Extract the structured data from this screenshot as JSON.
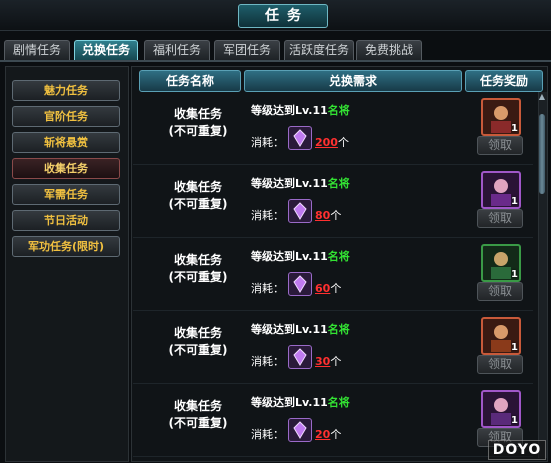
{
  "window": {
    "title": "任务"
  },
  "tabs": [
    {
      "label": "剧情任务",
      "active": false
    },
    {
      "label": "兑换任务",
      "active": true
    },
    {
      "label": "福利任务",
      "active": false
    },
    {
      "label": "军团任务",
      "active": false
    },
    {
      "label": "活跃度任务",
      "active": false
    },
    {
      "label": "免费挑战",
      "active": false
    }
  ],
  "sidebar": {
    "items": [
      {
        "label": "魅力任务"
      },
      {
        "label": "官阶任务"
      },
      {
        "label": "斩将悬赏"
      },
      {
        "label": "收集任务",
        "selected": true
      },
      {
        "label": "军需任务"
      },
      {
        "label": "节日活动"
      },
      {
        "label": "军功任务(限时)"
      }
    ]
  },
  "table": {
    "headers": {
      "name": "任务名称",
      "requirement": "兑换需求",
      "reward": "任务奖励"
    },
    "rows": [
      {
        "name_line1": "收集任务",
        "name_line2": "(不可重复)",
        "req_prefix": "等级达到Lv.11",
        "req_suffix": "名将",
        "cost_label": "消耗：",
        "cost_value": "200",
        "cost_unit": "个",
        "reward_count": "1",
        "reward_color": "orange",
        "claim_label": "领取"
      },
      {
        "name_line1": "收集任务",
        "name_line2": "(不可重复)",
        "req_prefix": "等级达到Lv.11",
        "req_suffix": "名将",
        "cost_label": "消耗：",
        "cost_value": "80",
        "cost_unit": "个",
        "reward_count": "1",
        "reward_color": "purple",
        "claim_label": "领取"
      },
      {
        "name_line1": "收集任务",
        "name_line2": "(不可重复)",
        "req_prefix": "等级达到Lv.11",
        "req_suffix": "名将",
        "cost_label": "消耗：",
        "cost_value": "60",
        "cost_unit": "个",
        "reward_count": "1",
        "reward_color": "green",
        "claim_label": "领取"
      },
      {
        "name_line1": "收集任务",
        "name_line2": "(不可重复)",
        "req_prefix": "等级达到Lv.11",
        "req_suffix": "名将",
        "cost_label": "消耗：",
        "cost_value": "30",
        "cost_unit": "个",
        "reward_count": "1",
        "reward_color": "orange",
        "claim_label": "领取"
      },
      {
        "name_line1": "收集任务",
        "name_line2": "(不可重复)",
        "req_prefix": "等级达到Lv.11",
        "req_suffix": "名将",
        "cost_label": "消耗：",
        "cost_value": "20",
        "cost_unit": "个",
        "reward_count": "1",
        "reward_color": "purple",
        "claim_label": "领取"
      }
    ]
  },
  "watermark": {
    "text": "DOYO"
  },
  "colors": {
    "accent": "#2f7f8d",
    "gold_text": "#f0c040",
    "requirement_green": "#33e233",
    "cost_red": "#ff3030"
  },
  "icons": {
    "cost": "purple-gem-icon",
    "reward": "general-portrait-icon",
    "scroll_up": "arrow-up-icon"
  }
}
